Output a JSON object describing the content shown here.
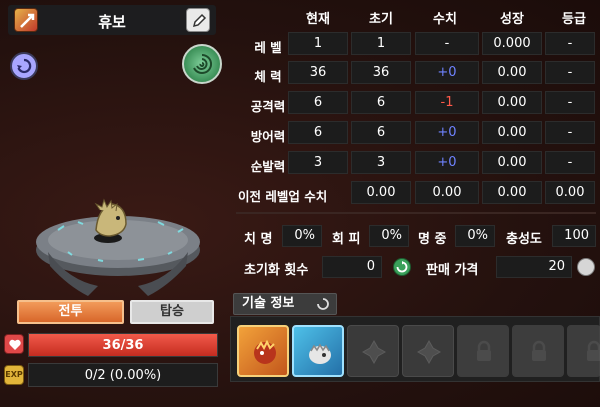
{
  "monster": {
    "name": "휴보",
    "hp_text": "36/36",
    "hp_fraction": 1.0,
    "exp_text": "0/2 (0.00%)",
    "exp_fraction": 0.0,
    "exp_icon_text": "EXP"
  },
  "tabs": {
    "battle": "전투",
    "ride": "탑승"
  },
  "stat_table": {
    "headers": [
      "현재",
      "초기",
      "수치",
      "성장",
      "등급"
    ],
    "rows": [
      {
        "label": "레 벨",
        "current": "1",
        "initial": "1",
        "bonus": "-",
        "bonus_type": "none",
        "growth": "0.000",
        "grade": "-"
      },
      {
        "label": "체 력",
        "current": "36",
        "initial": "36",
        "bonus": "+0",
        "bonus_type": "plus",
        "growth": "0.00",
        "grade": "-"
      },
      {
        "label": "공격력",
        "current": "6",
        "initial": "6",
        "bonus": "-1",
        "bonus_type": "minus",
        "growth": "0.00",
        "grade": "-"
      },
      {
        "label": "방어력",
        "current": "6",
        "initial": "6",
        "bonus": "+0",
        "bonus_type": "plus",
        "growth": "0.00",
        "grade": "-"
      },
      {
        "label": "순발력",
        "current": "3",
        "initial": "3",
        "bonus": "+0",
        "bonus_type": "plus",
        "growth": "0.00",
        "grade": "-"
      }
    ],
    "prev_levelup": {
      "label": "이전 레벨업 수치",
      "values": [
        "0.00",
        "0.00",
        "0.00",
        "0.00"
      ]
    }
  },
  "extra_stats": {
    "crit_label": "치 명",
    "crit_value": "0%",
    "evade_label": "회 피",
    "evade_value": "0%",
    "hit_label": "명 중",
    "hit_value": "0%",
    "loyalty_label": "충성도",
    "loyalty_value": "100",
    "reset_label": "초기화 횟수",
    "reset_value": "0",
    "price_label": "판매 가격",
    "price_value": "20"
  },
  "skills": {
    "tab_label": "기술 정보",
    "slots": [
      "fire-beast",
      "shell-beast",
      "empty",
      "empty",
      "locked",
      "locked",
      "locked"
    ]
  },
  "colors": {
    "hp": "#e04848",
    "bonus_plus": "#6f83ff",
    "bonus_minus": "#ff5a4a",
    "battle_tab": "#e57a3a"
  }
}
